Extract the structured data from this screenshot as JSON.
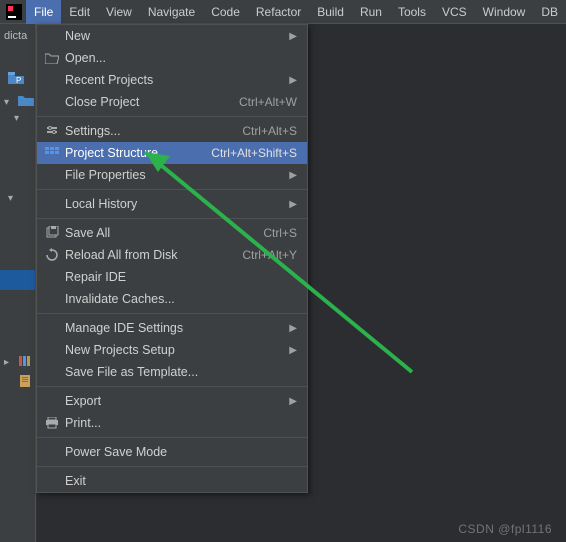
{
  "menubar": {
    "items": [
      "File",
      "Edit",
      "View",
      "Navigate",
      "Code",
      "Refactor",
      "Build",
      "Run",
      "Tools",
      "VCS",
      "Window",
      "DB Na"
    ],
    "active_index": 0
  },
  "sidebar": {
    "tab_label": "dicta"
  },
  "menu": {
    "sections": [
      [
        {
          "label": "New",
          "shortcut": "",
          "submenu": true,
          "icon": ""
        },
        {
          "label": "Open...",
          "shortcut": "",
          "submenu": false,
          "icon": "open"
        },
        {
          "label": "Recent Projects",
          "shortcut": "",
          "submenu": true,
          "icon": ""
        },
        {
          "label": "Close Project",
          "shortcut": "Ctrl+Alt+W",
          "submenu": false,
          "icon": ""
        }
      ],
      [
        {
          "label": "Settings...",
          "shortcut": "Ctrl+Alt+S",
          "submenu": false,
          "icon": "settings"
        },
        {
          "label": "Project Structure...",
          "shortcut": "Ctrl+Alt+Shift+S",
          "submenu": false,
          "icon": "structure",
          "highlight": true
        },
        {
          "label": "File Properties",
          "shortcut": "",
          "submenu": true,
          "icon": ""
        }
      ],
      [
        {
          "label": "Local History",
          "shortcut": "",
          "submenu": true,
          "icon": ""
        }
      ],
      [
        {
          "label": "Save All",
          "shortcut": "Ctrl+S",
          "submenu": false,
          "icon": "save"
        },
        {
          "label": "Reload All from Disk",
          "shortcut": "Ctrl+Alt+Y",
          "submenu": false,
          "icon": "reload"
        },
        {
          "label": "Repair IDE",
          "shortcut": "",
          "submenu": false,
          "icon": ""
        },
        {
          "label": "Invalidate Caches...",
          "shortcut": "",
          "submenu": false,
          "icon": ""
        }
      ],
      [
        {
          "label": "Manage IDE Settings",
          "shortcut": "",
          "submenu": true,
          "icon": ""
        },
        {
          "label": "New Projects Setup",
          "shortcut": "",
          "submenu": true,
          "icon": ""
        },
        {
          "label": "Save File as Template...",
          "shortcut": "",
          "submenu": false,
          "icon": ""
        }
      ],
      [
        {
          "label": "Export",
          "shortcut": "",
          "submenu": true,
          "icon": ""
        },
        {
          "label": "Print...",
          "shortcut": "",
          "submenu": false,
          "icon": "print"
        }
      ],
      [
        {
          "label": "Power Save Mode",
          "shortcut": "",
          "submenu": false,
          "icon": ""
        }
      ],
      [
        {
          "label": "Exit",
          "shortcut": "",
          "submenu": false,
          "icon": ""
        }
      ]
    ]
  },
  "watermark": "CSDN @fpl1116"
}
